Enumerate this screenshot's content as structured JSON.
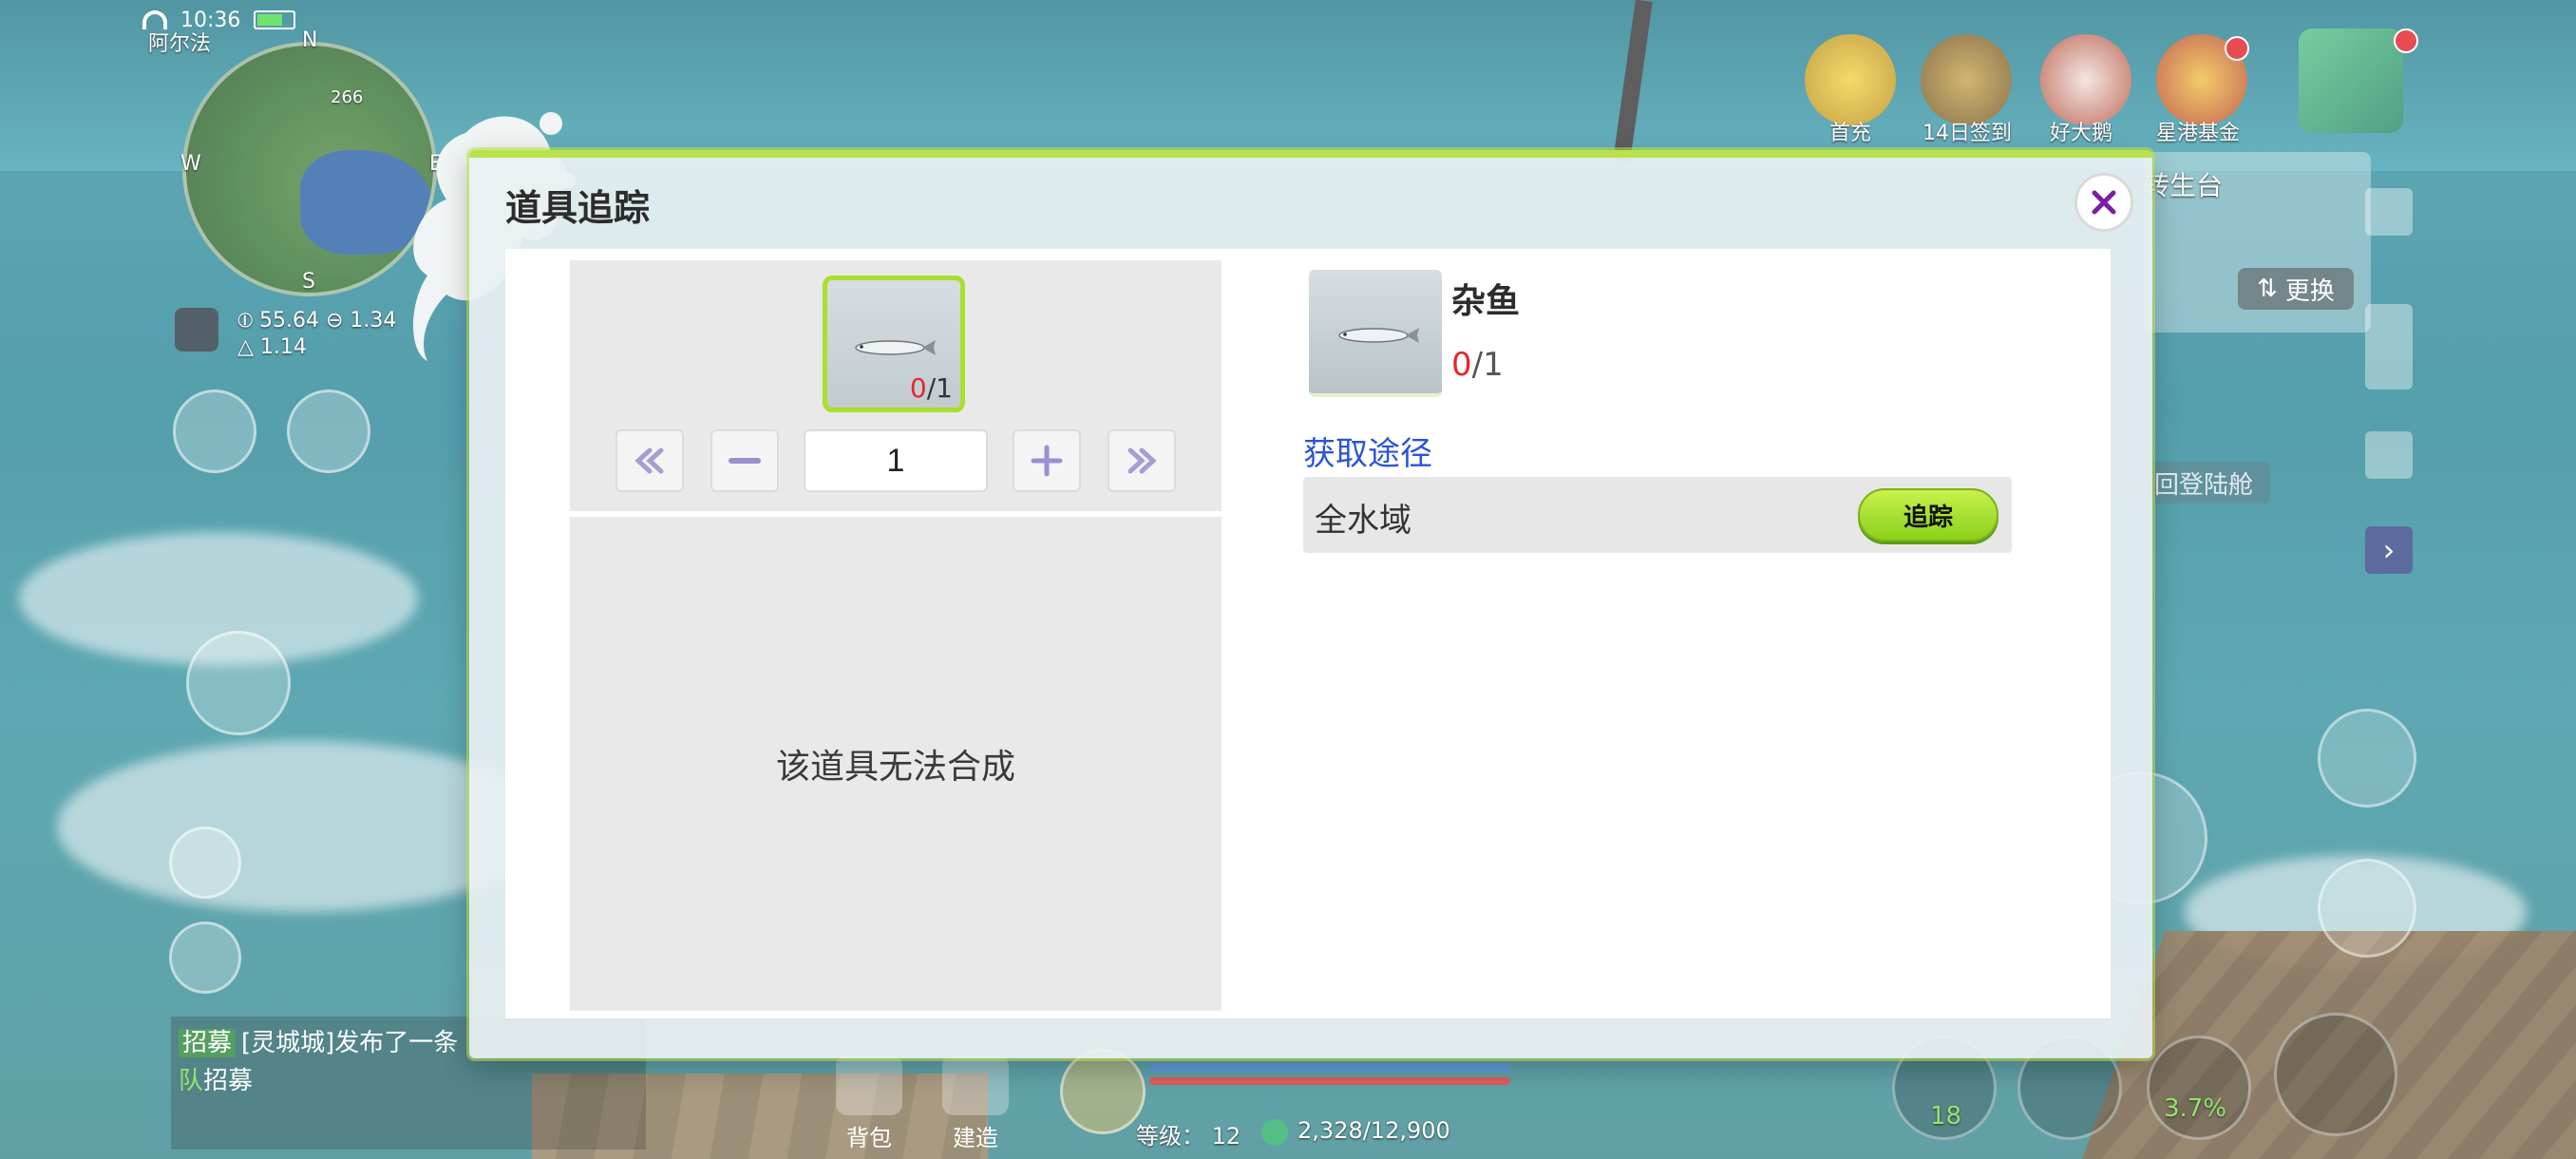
{
  "status_bar": {
    "time": "10:36"
  },
  "hud": {
    "player_name": "阿尔法",
    "compass": {
      "n": "N",
      "s": "S",
      "w": "W",
      "e": "E"
    },
    "map_marker": "266",
    "coord_a": "55.64",
    "coord_b": "1.34",
    "coord_c": "1.14",
    "top_icons": [
      {
        "label": "首充",
        "icon": "first-recharge-icon"
      },
      {
        "label": "14日签到",
        "icon": "dragon-icon"
      },
      {
        "label": "好大鹅",
        "icon": "goose-icon"
      },
      {
        "label": "星港基金",
        "icon": "fund-badge-icon"
      }
    ],
    "side_panel_title": "转生台",
    "swap_label": "更换",
    "login_pod_label": "回登陆舱",
    "chat": {
      "tag": "招募",
      "line1": "[灵城城]发布了一条",
      "tag2": "队",
      "line2": "招募"
    },
    "bag_label": "背包",
    "build_label": "建造",
    "level_label": "等级：",
    "level_value": "12",
    "exp_value": "2,328/12,900",
    "slot1_count": "18",
    "slot3_percent": "3.7%"
  },
  "dialog": {
    "title": "道具追踪",
    "close_icon": "close-icon",
    "item": {
      "count_have": "0",
      "count_need": "/1",
      "quantity": "1"
    },
    "cannot_craft": "该道具无法合成",
    "detail": {
      "name": "杂鱼",
      "count_have": "0",
      "count_need": "/1"
    },
    "acquisition_title": "获取途径",
    "sources": [
      {
        "label": "全水域",
        "button": "追踪"
      }
    ]
  },
  "colors": {
    "accent_green": "#a9e02f",
    "link_blue": "#2b55d6",
    "count_red": "#e8262d"
  }
}
